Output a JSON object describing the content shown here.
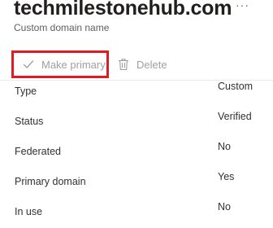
{
  "header": {
    "title": "techmilestonehub.com",
    "subtitle": "Custom domain name",
    "more_label": "···",
    "more_icon": "ellipsis-icon"
  },
  "commands": {
    "make_primary": {
      "label": "Make primary",
      "icon": "checkmark-icon",
      "enabled": false,
      "highlighted": true
    },
    "delete": {
      "label": "Delete",
      "icon": "trash-icon",
      "enabled": false
    }
  },
  "colors": {
    "highlight_border": "#e01b24",
    "disabled_text": "#a19f9d",
    "text": "#323130"
  },
  "properties": [
    {
      "label": "Type",
      "value": "Custom"
    },
    {
      "label": "Status",
      "value": "Verified"
    },
    {
      "label": "Federated",
      "value": "No"
    },
    {
      "label": "Primary domain",
      "value": "Yes"
    },
    {
      "label": "In use",
      "value": "No"
    }
  ]
}
